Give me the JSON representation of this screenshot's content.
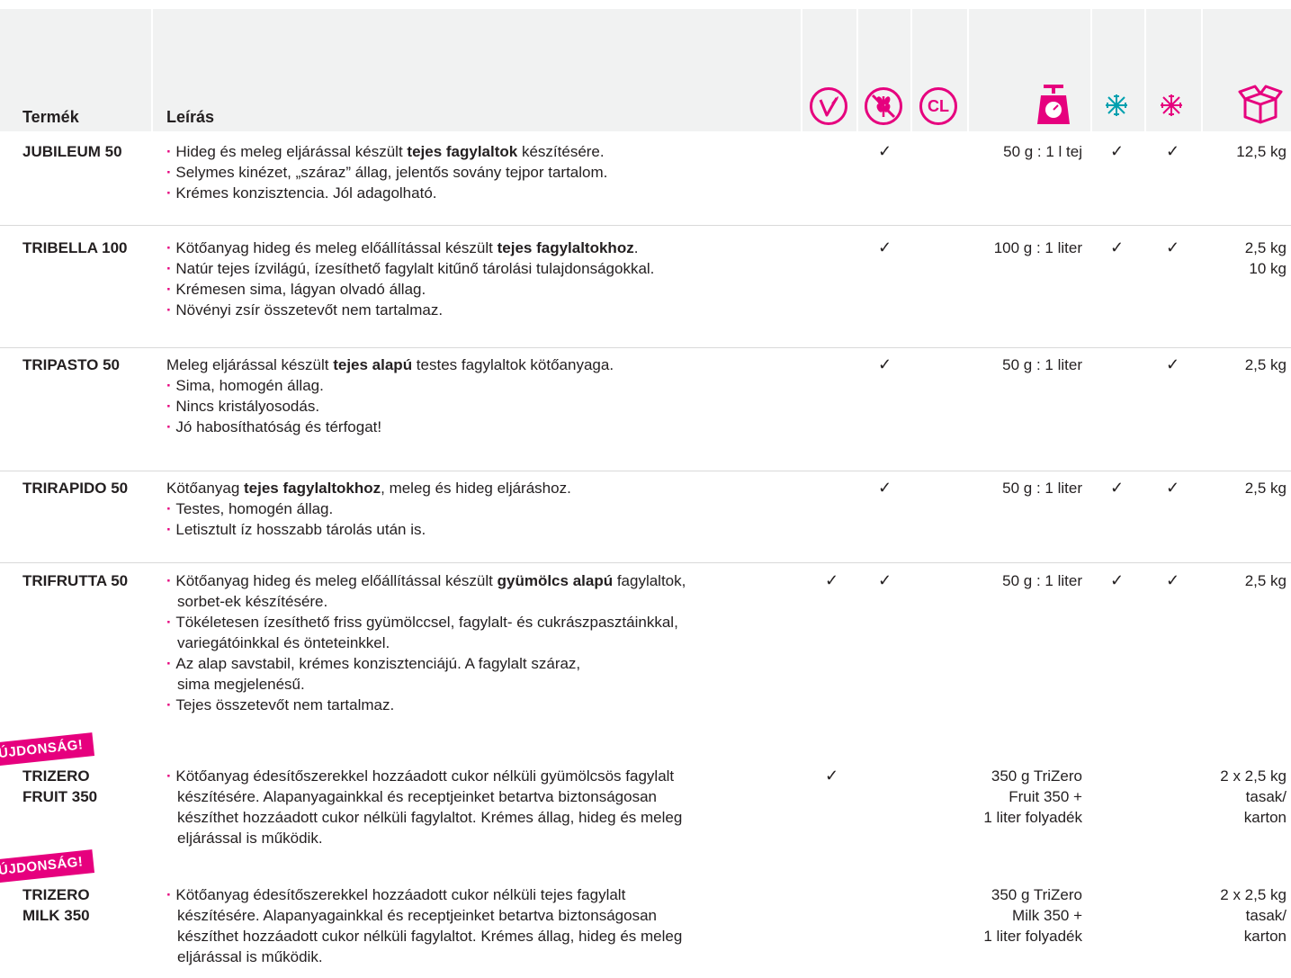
{
  "header": {
    "product_label": "Termék",
    "description_label": "Leírás",
    "icons": [
      "vegan-icon",
      "gluten-free-icon",
      "clean-label-icon",
      "scale-icon",
      "snowflake-cyan-icon",
      "snowflake-pink-icon",
      "box-icon"
    ],
    "icon_text_cl": "CL"
  },
  "colors": {
    "accent": "#e6007e",
    "cyan": "#00a0af",
    "header_bg": "#f1f2f2"
  },
  "badges": [
    "ÚJDONSÁG!",
    "ÚJDONSÁG!"
  ],
  "rows": [
    {
      "name": "JUBILEUM 50",
      "lines": [
        {
          "bullet": true,
          "pre": "Hideg és meleg eljárással készült ",
          "bold": "tejes fagylaltok",
          "post": " készítésére."
        },
        {
          "bullet": true,
          "pre": "Selymes kinézet, „száraz” állag, jelentős sovány tejpor tartalom.",
          "bold": "",
          "post": ""
        },
        {
          "bullet": true,
          "pre": "Krémes konzisztencia. Jól adagolható.",
          "bold": "",
          "post": ""
        }
      ],
      "check1": "",
      "check2": "✓",
      "dose": [
        "50 g : 1 l tej"
      ],
      "snow1": "✓",
      "snow2": "✓",
      "pack": [
        "12,5 kg"
      ]
    },
    {
      "name": "TRIBELLA 100",
      "lines": [
        {
          "bullet": true,
          "pre": "Kötőanyag hideg és meleg előállítással készült ",
          "bold": "tejes fagylaltokhoz",
          "post": "."
        },
        {
          "bullet": true,
          "pre": "Natúr tejes ízvilágú, ízesíthető fagylalt kitűnő tárolási tulajdonságokkal.",
          "bold": "",
          "post": ""
        },
        {
          "bullet": true,
          "pre": "Krémesen sima, lágyan olvadó állag.",
          "bold": "",
          "post": ""
        },
        {
          "bullet": true,
          "pre": "Növényi zsír összetevőt nem tartalmaz.",
          "bold": "",
          "post": ""
        }
      ],
      "check1": "",
      "check2": "✓",
      "dose": [
        "100 g : 1 liter"
      ],
      "snow1": "✓",
      "snow2": "✓",
      "pack": [
        "2,5 kg",
        "10 kg"
      ]
    },
    {
      "name": "TRIPASTO 50",
      "lines": [
        {
          "bullet": false,
          "pre": "Meleg eljárással készült ",
          "bold": "tejes alapú",
          "post": " testes fagylaltok kötőanyaga."
        },
        {
          "bullet": true,
          "pre": "Sima, homogén állag.",
          "bold": "",
          "post": ""
        },
        {
          "bullet": true,
          "pre": "Nincs kristályosodás.",
          "bold": "",
          "post": ""
        },
        {
          "bullet": true,
          "pre": "Jó habosíthatóság és térfogat!",
          "bold": "",
          "post": ""
        }
      ],
      "check1": "",
      "check2": "✓",
      "dose": [
        "50 g : 1 liter"
      ],
      "snow1": "",
      "snow2": "✓",
      "pack": [
        "2,5 kg"
      ]
    },
    {
      "name": "TRIRAPIDO 50",
      "lines": [
        {
          "bullet": false,
          "pre": "Kötőanyag ",
          "bold": "tejes fagylaltokhoz",
          "post": ", meleg és hideg eljáráshoz."
        },
        {
          "bullet": true,
          "pre": "Testes, homogén állag.",
          "bold": "",
          "post": ""
        },
        {
          "bullet": true,
          "pre": "Letisztult íz hosszabb tárolás után is.",
          "bold": "",
          "post": ""
        }
      ],
      "check1": "",
      "check2": "✓",
      "dose": [
        "50 g : 1 liter"
      ],
      "snow1": "✓",
      "snow2": "✓",
      "pack": [
        "2,5 kg"
      ]
    },
    {
      "name": "TRIFRUTTA 50",
      "lines": [
        {
          "bullet": true,
          "pre": "Kötőanyag hideg és meleg előállítással készült ",
          "bold": "gyümölcs alapú",
          "post": " fagylaltok,"
        },
        {
          "bullet": false,
          "indent": true,
          "pre": "sorbet-ek készítésére.",
          "bold": "",
          "post": ""
        },
        {
          "bullet": true,
          "pre": "Tökéletesen ízesíthető friss gyümölccsel, fagylalt- és cukrászpasztáinkkal,",
          "bold": "",
          "post": ""
        },
        {
          "bullet": false,
          "indent": true,
          "pre": "variegátóinkkal és önteteinkkel.",
          "bold": "",
          "post": ""
        },
        {
          "bullet": true,
          "pre": "Az alap savstabil, krémes konzisztenciájú. A fagylalt száraz,",
          "bold": "",
          "post": ""
        },
        {
          "bullet": false,
          "indent": true,
          "pre": "sima megjelenésű.",
          "bold": "",
          "post": ""
        },
        {
          "bullet": true,
          "pre": "Tejes összetevőt nem tartalmaz.",
          "bold": "",
          "post": ""
        }
      ],
      "check1": "✓",
      "check2": "✓",
      "dose": [
        "50 g : 1 liter"
      ],
      "snow1": "✓",
      "snow2": "✓",
      "pack": [
        "2,5 kg"
      ]
    },
    {
      "name": "TRIZERO",
      "name2": "FRUIT 350",
      "lines": [
        {
          "bullet": true,
          "pre": "Kötőanyag édesítőszerekkel hozzáadott cukor nélküli gyümölcsös fagylalt",
          "bold": "",
          "post": ""
        },
        {
          "bullet": false,
          "indent": true,
          "pre": "készítésére. Alapanyagainkkal és receptjeinket betartva biztonságosan",
          "bold": "",
          "post": ""
        },
        {
          "bullet": false,
          "indent": true,
          "pre": "készíthet hozzáadott cukor nélküli fagylaltot. Krémes állag, hideg és meleg",
          "bold": "",
          "post": ""
        },
        {
          "bullet": false,
          "indent": true,
          "pre": "eljárással is működik.",
          "bold": "",
          "post": ""
        }
      ],
      "check1": "✓",
      "check2": "",
      "dose": [
        "350 g TriZero",
        "Fruit 350 +",
        "1 liter folyadék"
      ],
      "snow1": "",
      "snow2": "",
      "pack": [
        "2 x 2,5 kg",
        "tasak/",
        "karton"
      ]
    },
    {
      "name": "TRIZERO",
      "name2": "MILK 350",
      "lines": [
        {
          "bullet": true,
          "pre": "Kötőanyag édesítőszerekkel hozzáadott cukor nélküli tejes fagylalt",
          "bold": "",
          "post": ""
        },
        {
          "bullet": false,
          "indent": true,
          "pre": "készítésére. Alapanyagainkkal és receptjeinket betartva biztonságosan",
          "bold": "",
          "post": ""
        },
        {
          "bullet": false,
          "indent": true,
          "pre": "készíthet hozzáadott cukor nélküli fagylaltot. Krémes állag, hideg és meleg",
          "bold": "",
          "post": ""
        },
        {
          "bullet": false,
          "indent": true,
          "pre": "eljárással is működik.",
          "bold": "",
          "post": ""
        }
      ],
      "check1": "",
      "check2": "",
      "dose": [
        "350 g TriZero",
        "Milk 350 +",
        "1 liter folyadék"
      ],
      "snow1": "",
      "snow2": "",
      "pack": [
        "2 x 2,5 kg",
        "tasak/",
        "karton"
      ]
    }
  ]
}
